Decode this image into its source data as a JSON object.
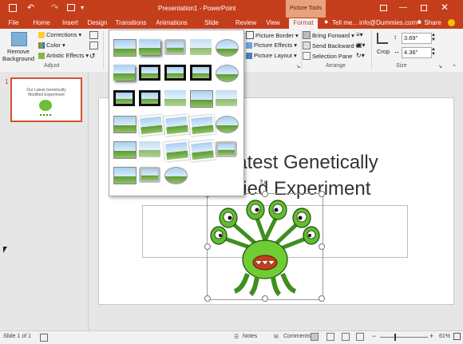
{
  "window": {
    "title": "Presentation1 - PowerPoint",
    "contextual_group": "Picture Tools",
    "user": "info@Dummies.com",
    "share": "Share"
  },
  "tabs": [
    "File",
    "Home",
    "Insert",
    "Design",
    "Transitions",
    "Animations",
    "Slide Show",
    "Review",
    "View",
    "Format"
  ],
  "tell_me": "Tell me...",
  "ribbon": {
    "remove_background": "Remove Background",
    "corrections": "Corrections",
    "color": "Color",
    "artistic_effects": "Artistic Effects",
    "adjust_group": "Adjust",
    "picture_border": "Picture Border",
    "picture_effects": "Picture Effects",
    "picture_layout": "Picture Layout",
    "bring_forward": "Bring Forward",
    "send_backward": "Send Backward",
    "selection_pane": "Selection Pane",
    "arrange_group": "Arrange",
    "crop": "Crop",
    "height": "3.69\"",
    "width": "4.36\"",
    "size_group": "Size"
  },
  "thumbnail": {
    "number": "1",
    "title": "Our Latest Genetically Modified Experiment"
  },
  "slide": {
    "title_line1": "Our Latest Genetically",
    "title_line2": "Modified Experiment"
  },
  "status": {
    "slide": "Slide 1 of 1",
    "notes": "Notes",
    "comments": "Comments",
    "zoom": "61%"
  },
  "colors": {
    "accent": "#c43e1c",
    "ribbon": "#f3f3f3"
  },
  "gallery": {
    "rows": 6,
    "columns": 5,
    "count": 28
  }
}
